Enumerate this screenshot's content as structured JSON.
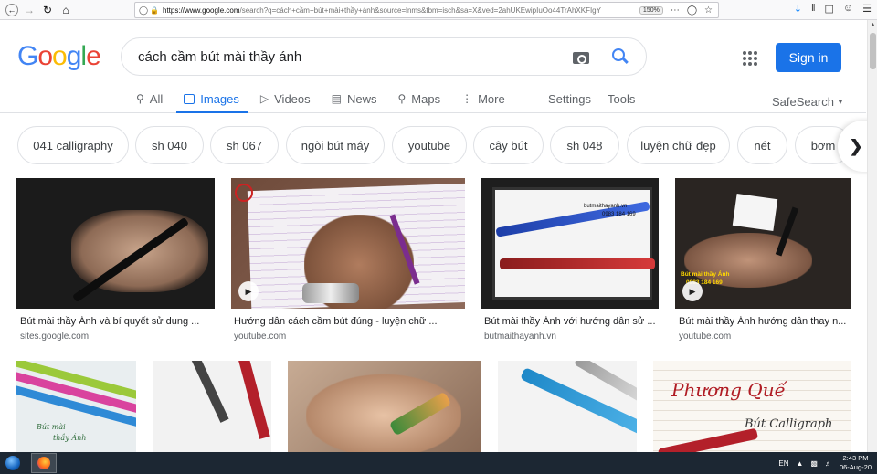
{
  "browser": {
    "url_prefix": "https://www.google.com",
    "url_rest": "/search?q=cách+cầm+bút+mài+thầy+ánh&source=lnms&tbm=isch&sa=X&ved=2ahUKEwipIuOo44TrAhXKFIgY",
    "zoom": "150%"
  },
  "search": {
    "query": "cách cầm bút mài thầy ánh",
    "sign_in": "Sign in"
  },
  "tabs": [
    "All",
    "Images",
    "Videos",
    "News",
    "Maps",
    "More"
  ],
  "tools": {
    "settings": "Settings",
    "tools": "Tools",
    "safesearch": "SafeSearch"
  },
  "chips": [
    "041 calligraphy",
    "sh 040",
    "sh 067",
    "ngòi bút máy",
    "youtube",
    "cây bút",
    "sh 048",
    "luyện chữ đẹp",
    "nét",
    "bơm"
  ],
  "results": [
    {
      "caption": "Bút mài thầy Ánh và bí quyết sử dụng ...",
      "source": "sites.google.com"
    },
    {
      "caption": "Hướng dẫn cách cầm bút đúng - luyện chữ ...",
      "source": "youtube.com"
    },
    {
      "caption": "Bút mài thầy Ánh với hướng dẫn sử ...",
      "source": "butmaithayanh.vn"
    },
    {
      "caption": "Bút mài thầy Ánh hướng dẫn thay n...",
      "source": "youtube.com"
    }
  ],
  "image_text": {
    "card3_line1": "butmaithayanh.vn",
    "card3_line2": "0983 184 169",
    "card4_line1": "Bút mài thầy Ánh",
    "card4_line2": "0983 184 169",
    "card5_line1": "Bút mài",
    "card5_line2": "thầy Ánh",
    "card9_line1": "Phương Quế",
    "card9_line2": "Bút Calligraph"
  },
  "taskbar": {
    "lang": "EN",
    "time": "2:43 PM",
    "date": "06-Aug-20"
  }
}
